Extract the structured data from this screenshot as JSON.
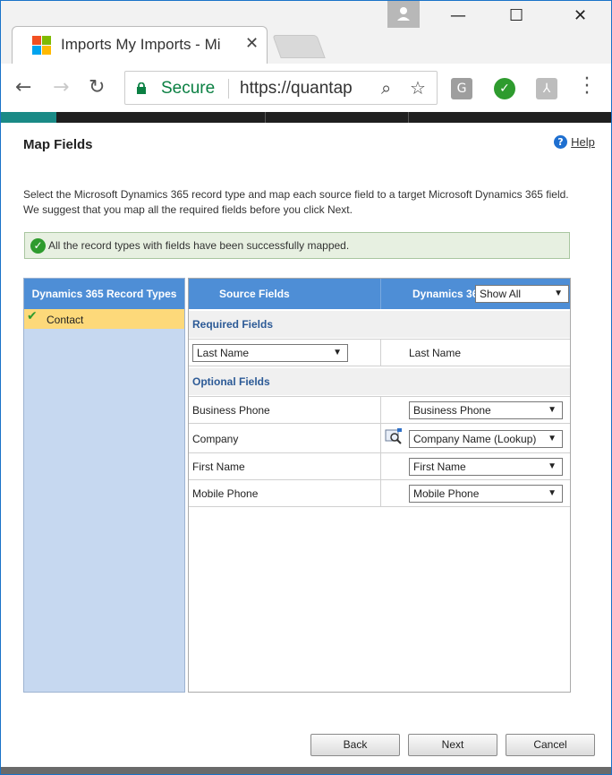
{
  "browser": {
    "tab_title": "Imports My Imports - Mi",
    "tab_close": "✕",
    "address_secure": "Secure",
    "address_url": "https://quantap",
    "window_minimize": "—",
    "window_maximize": "☐",
    "window_close": "✕",
    "extensions": [
      {
        "name": "g-extension-icon",
        "label": "G",
        "color": "#9e9e9e"
      },
      {
        "name": "check-extension-icon",
        "label": "✓",
        "color": "#2e9b2e"
      },
      {
        "name": "pdf-extension-icon",
        "label": "⅄",
        "color": "#bdbdbd"
      }
    ]
  },
  "page": {
    "title": "Map Fields",
    "help_label": "Help",
    "help_icon": "?",
    "description": "Select the Microsoft Dynamics 365 record type and map each source field to a target Microsoft Dynamics 365 field. We suggest that you map all the required fields before you click Next.",
    "success_message": "All the record types with fields have been successfully mapped."
  },
  "record_types": {
    "header": "Dynamics 365 Record Types",
    "items": [
      {
        "label": "Contact",
        "selected": true,
        "mapped": true
      }
    ]
  },
  "grid": {
    "header_source": "Source Fields",
    "header_dynamics": "Dynamics 365 Fields",
    "filter_value": "Show All",
    "required_section": "Required Fields",
    "required_rows": [
      {
        "source": "Last Name",
        "target": "Last Name"
      }
    ],
    "optional_section": "Optional Fields",
    "optional_rows": [
      {
        "source": "Business Phone",
        "target": "Business Phone"
      },
      {
        "source": "Company",
        "target": "Company Name (Lookup)"
      },
      {
        "source": "First Name",
        "target": "First Name"
      },
      {
        "source": "Mobile Phone",
        "target": "Mobile Phone"
      }
    ]
  },
  "buttons": {
    "back": "Back",
    "next": "Next",
    "cancel": "Cancel"
  },
  "colors": {
    "header_blue": "#4e8ed6",
    "left_panel": "#c6d8f0",
    "selected_row": "#fdd97a",
    "success_green": "#2e9b2e",
    "section_text": "#2c5a96"
  }
}
